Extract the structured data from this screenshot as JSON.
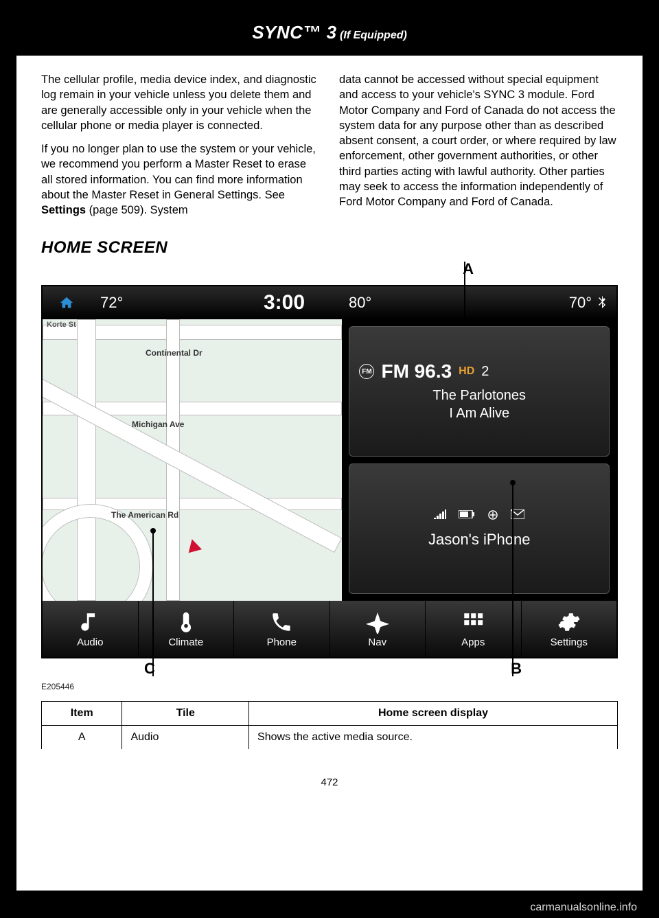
{
  "header": {
    "title": "SYNC™ 3",
    "subtitle": " (If Equipped)"
  },
  "body": {
    "col1_p1": "The cellular profile, media device index, and diagnostic log remain in your vehicle unless you delete them and are generally accessible only in your vehicle when the cellular phone or media player is connected.",
    "col1_p2_a": "If you no longer plan to use the system or your vehicle, we recommend you perform a Master Reset to erase all stored information. You can find more information about the Master Reset in General Settings.  See ",
    "col1_p2_bold": "Settings",
    "col1_p2_b": " (page 509).  System",
    "col2_p1": "data cannot be accessed without special equipment and access to your vehicle's SYNC 3 module. Ford Motor Company and Ford of Canada do not access the system data for any purpose other than as described absent consent, a court order, or where required by law enforcement, other government authorities, or other third parties acting with lawful authority. Other parties may seek to access the information independently of Ford Motor Company and Ford of Canada."
  },
  "section_heading": "HOME SCREEN",
  "callouts": {
    "a": "A",
    "b": "B",
    "c": "C"
  },
  "screen": {
    "temp_left": "72°",
    "clock": "3:00",
    "temp_mid": "80°",
    "temp_right": "70°",
    "roads": {
      "korte": "Korte St",
      "continental": "Continental Dr",
      "michigan": "Michigan Ave",
      "american": "The American Rd"
    },
    "audio": {
      "fm_label": "FM",
      "station": "FM 96.3",
      "hd": "HD",
      "hd_num": "2",
      "artist": "The Parlotones",
      "track": "I Am Alive"
    },
    "phone": {
      "name": "Jason's iPhone"
    },
    "nav": {
      "audio": "Audio",
      "climate": "Climate",
      "phone": "Phone",
      "nav": "Nav",
      "apps": "Apps",
      "settings": "Settings"
    }
  },
  "figure_id": "E205446",
  "table": {
    "h1": "Item",
    "h2": "Tile",
    "h3": "Home screen display",
    "r1c1": "A",
    "r1c2": "Audio",
    "r1c3": "Shows the active media source."
  },
  "page_number": "472",
  "watermark": "carmanualsonline.info"
}
